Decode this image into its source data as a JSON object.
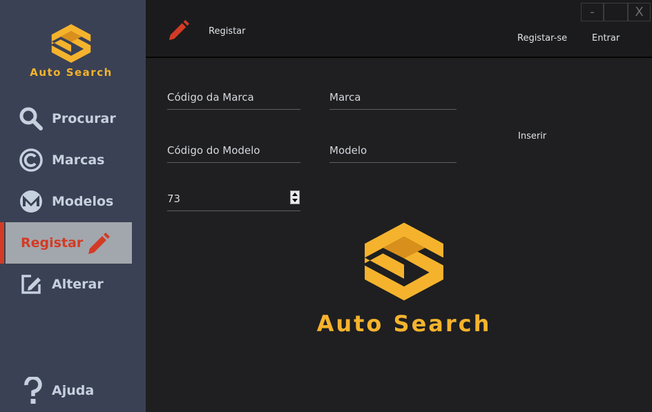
{
  "app": {
    "brand_name": "Auto Search"
  },
  "sidebar": {
    "items": [
      {
        "label": "Procurar",
        "icon": "search-icon"
      },
      {
        "label": "Marcas",
        "icon": "copyright-icon"
      },
      {
        "label": "Modelos",
        "icon": "monero-icon"
      },
      {
        "label": "Registar",
        "icon": "pencil-icon",
        "active": true
      },
      {
        "label": "Alterar",
        "icon": "edit-icon"
      }
    ],
    "help": {
      "label": "Ajuda",
      "icon": "question-icon"
    }
  },
  "header": {
    "title": "Registar",
    "links": {
      "register": "Registar-se",
      "login": "Entrar"
    },
    "window_controls": {
      "minimize": "-",
      "close": "X"
    }
  },
  "form": {
    "brand_code_placeholder": "Código da Marca",
    "brand_placeholder": "Marca",
    "model_code_placeholder": "Código do Modelo",
    "model_placeholder": "Modelo",
    "number_value": "73",
    "insert_label": "Inserir"
  },
  "logo": {
    "name": "Auto Search"
  },
  "colors": {
    "accent": "#f5b32d",
    "active_red": "#d23b25",
    "sidebar_bg": "#3a4154",
    "main_bg": "#1f1f21"
  }
}
